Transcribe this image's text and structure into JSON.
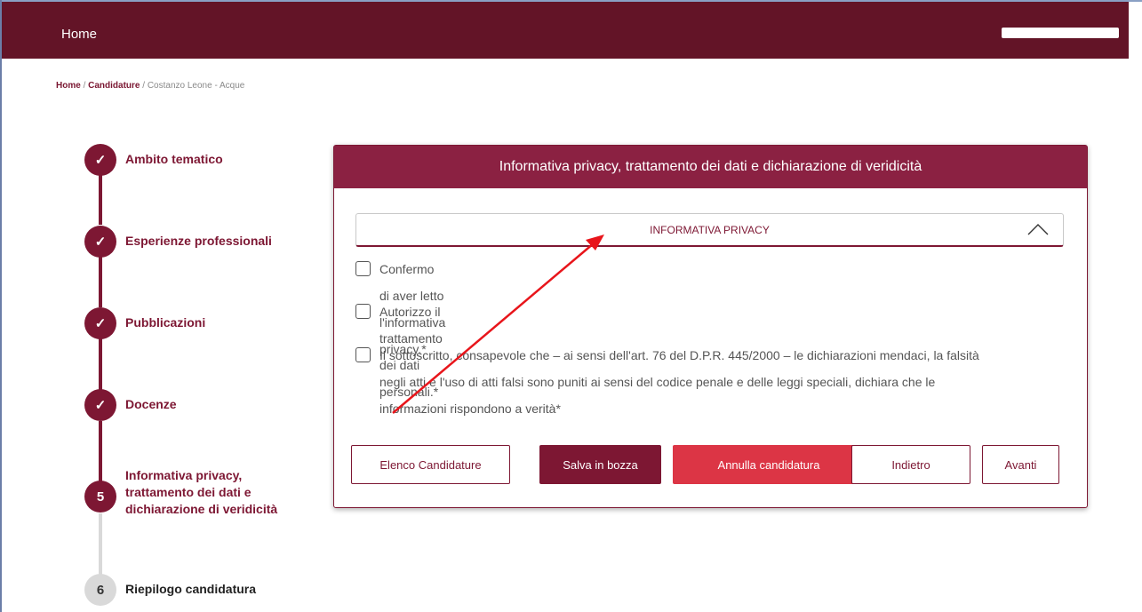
{
  "header": {
    "home_label": "Home"
  },
  "breadcrumb": {
    "home": "Home",
    "sep1": " / ",
    "candidature": "Candidature",
    "sep2": " / ",
    "current": "Costanzo Leone - Acque"
  },
  "stepper": {
    "steps": [
      {
        "marker": "✓",
        "label": "Ambito tematico"
      },
      {
        "marker": "✓",
        "label": "Esperienze professionali"
      },
      {
        "marker": "✓",
        "label": "Pubblicazioni"
      },
      {
        "marker": "✓",
        "label": "Docenze"
      },
      {
        "marker": "5",
        "label_line1": "Informativa privacy,",
        "label_line2": "trattamento dei dati e",
        "label_line3": "dichiarazione di veridicità"
      },
      {
        "marker": "6",
        "label": "Riepilogo candidatura"
      }
    ]
  },
  "card": {
    "title": "Informativa privacy, trattamento dei dati e dichiarazione di veridicità",
    "accordion_label": "INFORMATIVA PRIVACY",
    "checkbox1": "Confermo di aver letto l'informativa privacy.*",
    "checkbox2": "Autorizzo il trattamento dei dati personali.*",
    "checkbox3_line1": "Il sottoscritto, consapevole che – ai sensi dell'art. 76 del D.P.R. 445/2000 – le dichiarazioni mendaci, la falsità",
    "checkbox3_line2": "negli atti e l'uso di atti falsi sono puniti ai sensi del codice penale e delle leggi speciali, dichiara che le",
    "checkbox3_line3": "informazioni rispondono a verità*"
  },
  "buttons": {
    "elenco": "Elenco Candidature",
    "salva": "Salva in bozza",
    "annulla": "Annulla candidatura",
    "indietro": "Indietro",
    "avanti": "Avanti"
  },
  "colors": {
    "brand": "#631427",
    "accent": "#7d1733",
    "danger": "#dc3545",
    "annotation_arrow": "#e8151b"
  }
}
